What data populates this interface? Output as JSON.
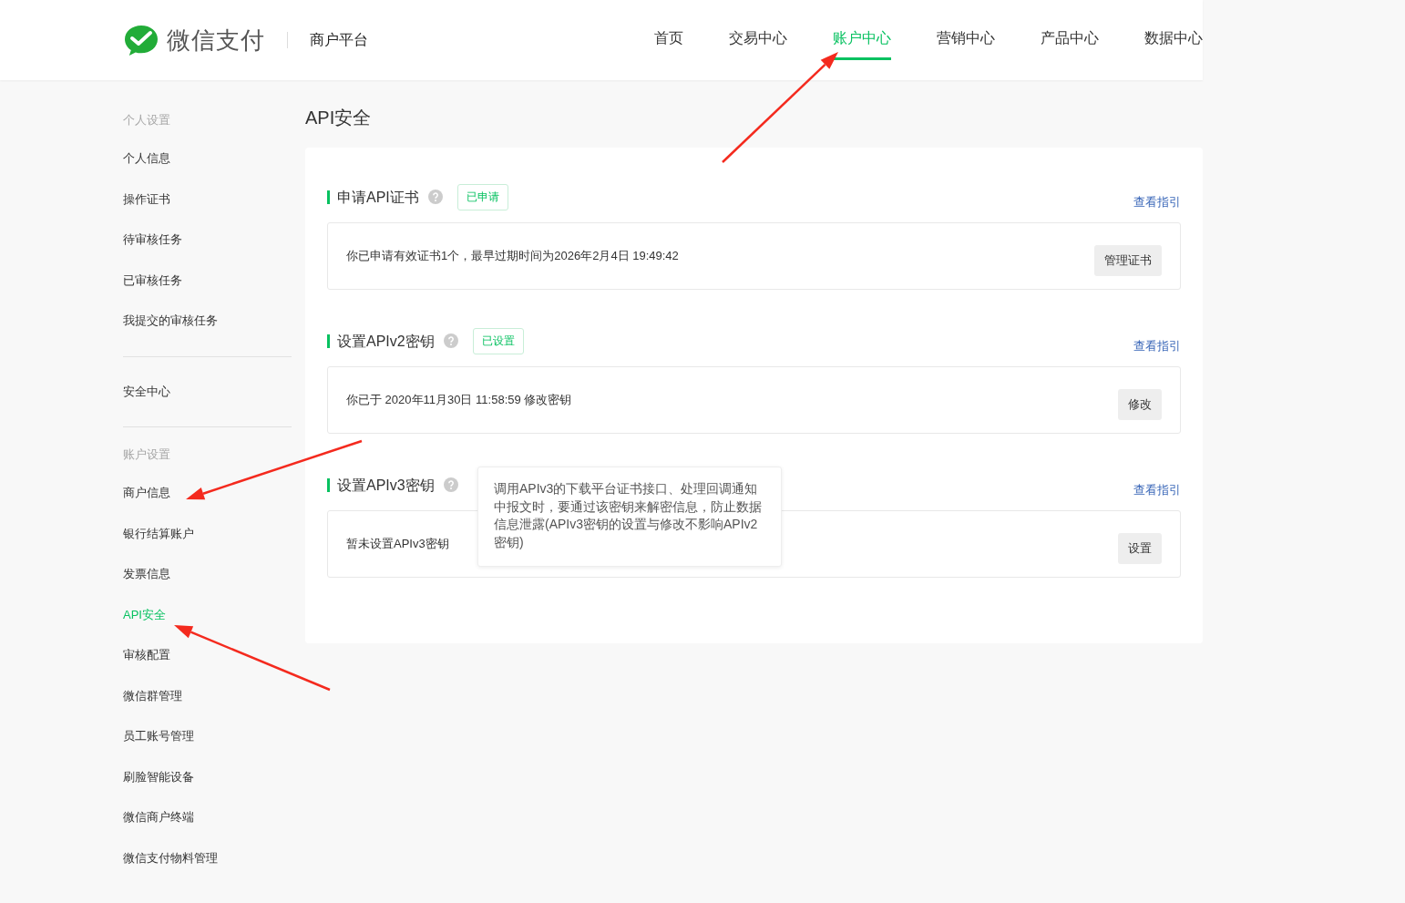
{
  "header": {
    "brand": "微信支付",
    "platform": "商户平台",
    "nav": [
      {
        "label": "首页",
        "selected": false
      },
      {
        "label": "交易中心",
        "selected": false
      },
      {
        "label": "账户中心",
        "selected": true
      },
      {
        "label": "营销中心",
        "selected": false
      },
      {
        "label": "产品中心",
        "selected": false
      },
      {
        "label": "数据中心",
        "selected": false
      }
    ]
  },
  "sidebar": {
    "groups": [
      {
        "title": "个人设置",
        "items": [
          {
            "label": "个人信息",
            "selected": false
          },
          {
            "label": "操作证书",
            "selected": false
          },
          {
            "label": "待审核任务",
            "selected": false
          },
          {
            "label": "已审核任务",
            "selected": false
          },
          {
            "label": "我提交的审核任务",
            "selected": false
          }
        ]
      },
      {
        "items": [
          {
            "label": "安全中心",
            "selected": false
          }
        ]
      },
      {
        "title": "账户设置",
        "items": [
          {
            "label": "商户信息",
            "selected": false
          },
          {
            "label": "银行结算账户",
            "selected": false
          },
          {
            "label": "发票信息",
            "selected": false
          },
          {
            "label": "API安全",
            "selected": true
          },
          {
            "label": "审核配置",
            "selected": false
          },
          {
            "label": "微信群管理",
            "selected": false
          },
          {
            "label": "员工账号管理",
            "selected": false
          },
          {
            "label": "刷脸智能设备",
            "selected": false
          },
          {
            "label": "微信商户终端",
            "selected": false
          },
          {
            "label": "微信支付物料管理",
            "selected": false
          }
        ]
      }
    ]
  },
  "page_title": "API安全",
  "sections": [
    {
      "title": "申请API证书",
      "badge": "已申请",
      "link": "查看指引",
      "text": "你已申请有效证书1个，最早过期时间为2026年2月4日 19:49:42",
      "button": "管理证书"
    },
    {
      "title": "设置APIv2密钥",
      "badge": "已设置",
      "link": "查看指引",
      "text": "你已于 2020年11月30日 11:58:59 修改密钥",
      "button": "修改"
    },
    {
      "title": "设置APIv3密钥",
      "link": "查看指引",
      "text": "暂未设置APIv3密钥",
      "button": "设置"
    }
  ],
  "tooltip": "调用APIv3的下载平台证书接口、处理回调通知中报文时，要通过该密钥来解密信息，防止数据信息泄露(APIv3密钥的设置与修改不影响APIv2密钥)"
}
